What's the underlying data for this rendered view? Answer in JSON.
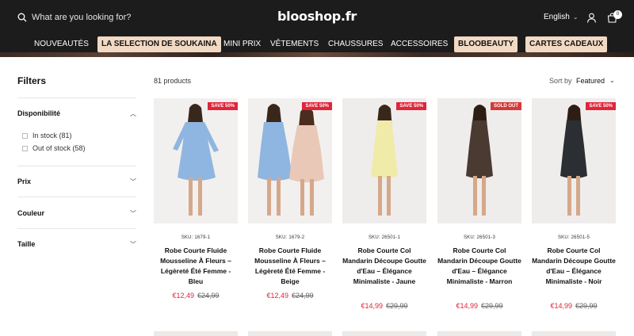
{
  "header": {
    "search_placeholder": "What are you looking for?",
    "logo": "blooshop.fr",
    "language": "English",
    "cart_count": "0"
  },
  "nav": {
    "items": [
      {
        "label": "NOUVEAUTÉS",
        "highlight": false
      },
      {
        "label": "LA SELECTION DE SOUKAINA",
        "highlight": true
      },
      {
        "label": "MINI PRIX",
        "highlight": false
      },
      {
        "label": "VÊTEMENTS",
        "highlight": false
      },
      {
        "label": "CHAUSSURES",
        "highlight": false
      },
      {
        "label": "ACCESSOIRES",
        "highlight": false
      },
      {
        "label": "BLOOBEAUTY",
        "highlight": true
      },
      {
        "label": "CARTES CADEAUX",
        "highlight": true
      }
    ]
  },
  "sidebar": {
    "title": "Filters",
    "sections": [
      {
        "label": "Disponibilité",
        "expanded": true,
        "options": [
          "In stock (81)",
          "Out of stock (58)"
        ]
      },
      {
        "label": "Prix",
        "expanded": false
      },
      {
        "label": "Couleur",
        "expanded": false
      },
      {
        "label": "Taille",
        "expanded": false
      }
    ]
  },
  "toolbar": {
    "count": "81 products",
    "sort_label": "Sort by",
    "sort_value": "Featured"
  },
  "products": [
    {
      "badge": "SAVE 50%",
      "sku": "SKU: 1679-1",
      "name": "Robe Courte Fluide Mousseline À Fleurs – Légèreté Été Femme - Bleu",
      "price": "€12,49",
      "compare": "€24,99",
      "dress_color": "#8fb6e0"
    },
    {
      "badge": "SAVE 50%",
      "sku": "SKU: 1679-2",
      "name": "Robe Courte Fluide Mousseline À Fleurs – Légèreté Été Femme - Beige",
      "price": "€12,49",
      "compare": "€24,99",
      "dress_color": "#e9c8b8"
    },
    {
      "badge": "SAVE 50%",
      "sku": "SKU: 26501-1",
      "name": "Robe Courte Col Mandarin Découpe Goutte d'Eau – Élégance Minimaliste - Jaune",
      "price": "€14,99",
      "compare": "€29,99",
      "dress_color": "#f1ebaa"
    },
    {
      "badge": "SOLD OUT",
      "sku": "SKU: 26501-3",
      "name": "Robe Courte Col Mandarin Découpe Goutte d'Eau – Élégance Minimaliste - Marron",
      "price": "€14,99",
      "compare": "€29,99",
      "dress_color": "#4a3a32"
    },
    {
      "badge": "SAVE 50%",
      "sku": "SKU: 26501-5",
      "name": "Robe Courte Col Mandarin Découpe Goutte d'Eau – Élégance Minimaliste - Noir",
      "price": "€14,99",
      "compare": "€29,99",
      "dress_color": "#2b2f33"
    }
  ]
}
